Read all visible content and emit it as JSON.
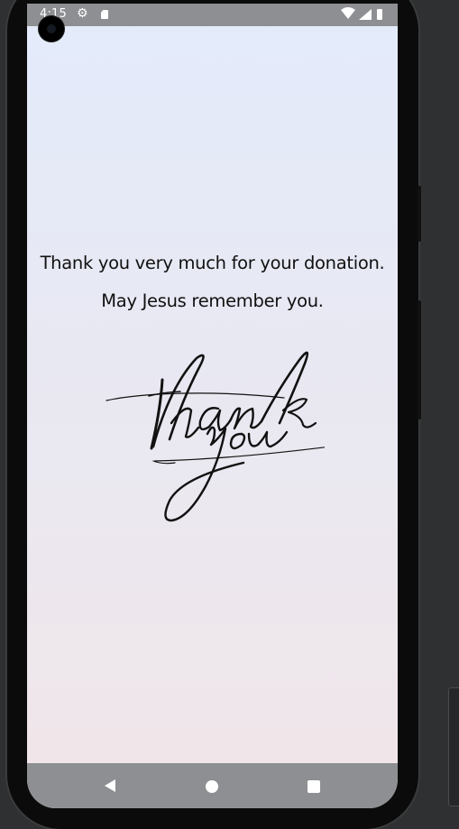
{
  "status_bar": {
    "time": "4:15",
    "icons": [
      "settings-gear-icon",
      "sd-card-icon",
      "wifi-icon",
      "cell-signal-icon",
      "battery-icon"
    ]
  },
  "content": {
    "message_line1": "Thank you very much for your donation.",
    "message_line2": "May Jesus remember you.",
    "artwork_text": "thank you"
  },
  "nav_bar": {
    "buttons": [
      "back-triangle-icon",
      "home-circle-icon",
      "recents-square-icon"
    ]
  },
  "colors": {
    "screen_top": "#e3ebfb",
    "screen_bottom": "#f1e6e9",
    "system_bars": "#8e8f92",
    "text": "#111111"
  }
}
